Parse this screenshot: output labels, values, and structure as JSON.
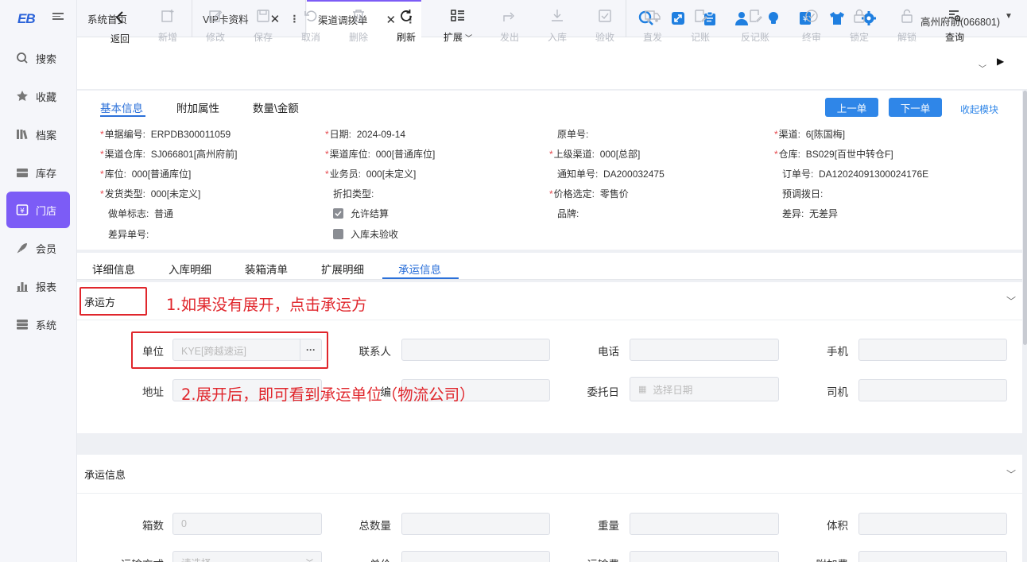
{
  "sidebar": {
    "logo": "EB",
    "items": [
      {
        "label": "搜索",
        "icon": "search-icon"
      },
      {
        "label": "收藏",
        "icon": "star-icon"
      },
      {
        "label": "档案",
        "icon": "books-icon"
      },
      {
        "label": "库存",
        "icon": "inventory-icon"
      },
      {
        "label": "门店",
        "icon": "store-icon",
        "active": true
      },
      {
        "label": "会员",
        "icon": "rocket-icon"
      },
      {
        "label": "报表",
        "icon": "bar-chart-icon"
      },
      {
        "label": "系统",
        "icon": "server-icon"
      }
    ]
  },
  "tabs": [
    {
      "label": "系统首页"
    },
    {
      "label": "VIP卡资料"
    },
    {
      "label": "渠道调拨单",
      "active": true
    }
  ],
  "header": {
    "icons": [
      "search-icon",
      "expand-icon",
      "clipboard-icon",
      "user-icon",
      "bulb-icon",
      "yen-icon",
      "shirt-icon",
      "gear-icon"
    ],
    "user": "高州府前(066801)"
  },
  "toolbar": {
    "back": "返回",
    "add": "新增",
    "edit": "修改",
    "save": "保存",
    "cancel": "取消",
    "delete": "删除",
    "refresh": "刷新",
    "expand": "扩展",
    "send": "发出",
    "stock_in": "入库",
    "inspect": "验收",
    "direct": "直发",
    "post": "记账",
    "unpost": "反记账",
    "final": "终审",
    "lock": "锁定",
    "unlock": "解锁",
    "query": "查询"
  },
  "form_tabs": {
    "basic": "基本信息",
    "extra": "附加属性",
    "qty": "数量\\金额"
  },
  "buttons": {
    "prev": "上一单",
    "next": "下一单",
    "collapse": "收起模块"
  },
  "fields": {
    "doc_no_label": "单据编号:",
    "doc_no": "ERPDB300011059",
    "date_label": "日期:",
    "date": "2024-09-14",
    "orig_no_label": "原单号:",
    "channel_label": "渠道:",
    "channel": "6[陈国梅]",
    "channel_wh_label": "渠道仓库:",
    "channel_wh": "SJ066801[高州府前]",
    "channel_loc_label": "渠道库位:",
    "channel_loc": "000[普通库位]",
    "parent_channel_label": "上级渠道:",
    "parent_channel": "000[总部]",
    "warehouse_label": "仓库:",
    "warehouse": "BS029[百世中转仓F]",
    "loc_label": "库位:",
    "loc": "000[普通库位]",
    "sales_label": "业务员:",
    "sales": "000[未定义]",
    "notice_no_label": "通知单号:",
    "notice_no": "DA200032475",
    "order_no_label": "订单号:",
    "order_no": "DA12024091300024176E",
    "ship_type_label": "发货类型:",
    "ship_type": "000[未定义]",
    "discount_label": "折扣类型:",
    "price_label": "价格选定:",
    "price": "零售价",
    "pre_date_label": "预调拨日:",
    "maker_label": "做单标志:",
    "maker": "普通",
    "allow_settle": "允许结算",
    "brand_label": "品牌:",
    "diff_label": "差异:",
    "diff": "无差异",
    "diff_no_label": "差异单号:",
    "unchecked_in": "入库未验收"
  },
  "detail_tabs": [
    "详细信息",
    "入库明细",
    "装箱清单",
    "扩展明细",
    "承运信息"
  ],
  "carrier": {
    "title": "承运方",
    "unit_label": "单位",
    "unit_value": "KYE[跨越速运]",
    "contact_label": "联系人",
    "phone_label": "电话",
    "mobile_label": "手机",
    "address_label": "地址",
    "code_label": "编",
    "entrust_label": "委托日",
    "entrust_placeholder": "选择日期",
    "driver_label": "司机"
  },
  "shipping": {
    "title": "承运信息",
    "boxes_label": "箱数",
    "boxes_value": "0",
    "total_qty_label": "总数量",
    "weight_label": "重量",
    "volume_label": "体积",
    "transport_label": "运输方式",
    "transport_placeholder": "请选择",
    "unit_price_label": "单价",
    "freight_label": "运输费",
    "surcharge_label": "附加费"
  },
  "annotations": {
    "step1": "1.如果没有展开，点击承运方",
    "step2": "2.展开后，即可看到承运单位（物流公司）"
  }
}
